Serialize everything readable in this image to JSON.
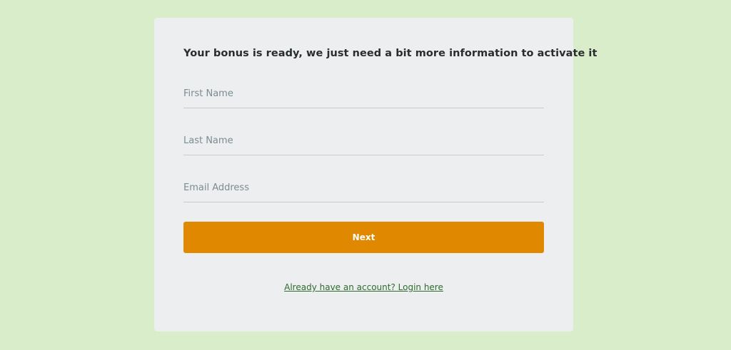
{
  "form": {
    "heading": "Your bonus is ready, we just need a bit more information to activate it",
    "first_name_placeholder": "First Name",
    "last_name_placeholder": "Last Name",
    "email_placeholder": "Email Address",
    "next_label": "Next",
    "login_link": "Already have an account? Login here"
  },
  "colors": {
    "page_background": "#d9edca",
    "card_background": "#eceeef",
    "button_background": "#e08800",
    "link_color": "#2f6b2f"
  }
}
